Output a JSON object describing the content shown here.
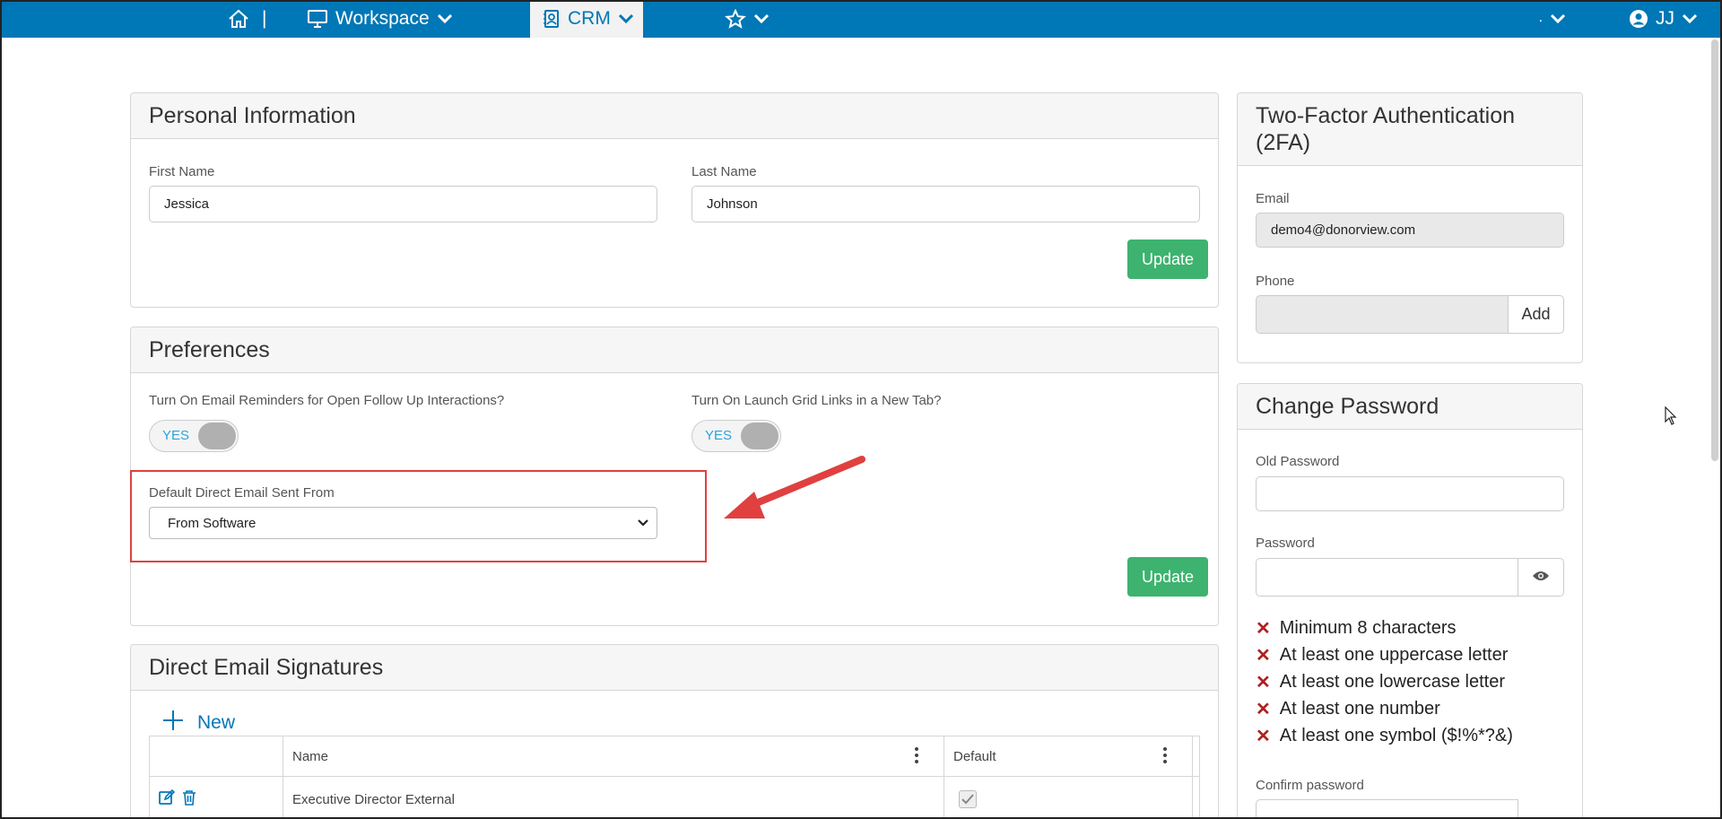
{
  "topbar": {
    "home_sep": "|",
    "workspace_label": "Workspace",
    "crm_label": "CRM",
    "misc_label": "⸳",
    "user_initials": "JJ"
  },
  "personal": {
    "title": "Personal Information",
    "first_name_label": "First Name",
    "first_name_value": "Jessica",
    "last_name_label": "Last Name",
    "last_name_value": "Johnson",
    "update_label": "Update"
  },
  "preferences": {
    "title": "Preferences",
    "reminders_label": "Turn On Email Reminders for Open Follow Up Interactions?",
    "reminders_toggle": "YES",
    "grid_links_label": "Turn On Launch Grid Links in a New Tab?",
    "grid_links_toggle": "YES",
    "sent_from_label": "Default Direct Email Sent From",
    "sent_from_value": "From Software",
    "update_label": "Update"
  },
  "signatures": {
    "title": "Direct Email Signatures",
    "new_label": "New",
    "columns": [
      "Name",
      "Default"
    ],
    "rows": [
      {
        "name": "Executive Director External",
        "default": true
      }
    ]
  },
  "twofa": {
    "title": "Two-Factor Authentication (2FA)",
    "email_label": "Email",
    "email_value": "demo4@donorview.com",
    "phone_label": "Phone",
    "phone_value": "",
    "add_label": "Add"
  },
  "change_password": {
    "title": "Change Password",
    "old_label": "Old Password",
    "password_label": "Password",
    "requirements": [
      "Minimum 8 characters",
      "At least one uppercase letter",
      "At least one lowercase letter",
      "At least one number",
      "At least one symbol ($!%*?&)"
    ],
    "confirm_label": "Confirm password"
  },
  "colors": {
    "topbar": "#0077b6",
    "accent_green": "#3db36f",
    "highlight_red": "#e04040",
    "error_x": "#b02020"
  }
}
